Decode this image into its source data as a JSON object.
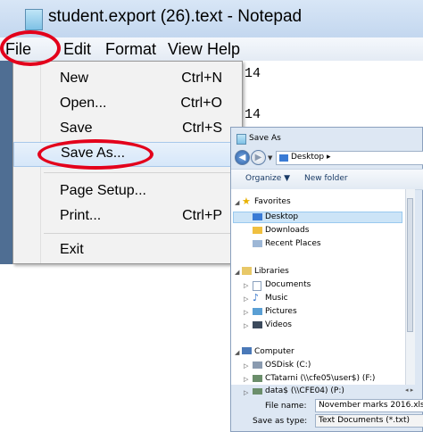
{
  "notepad": {
    "title": "student.export (26).text - Notepad",
    "menu": [
      "File",
      "Edit",
      "Format",
      "View",
      "Help"
    ],
    "text_fragments": [
      "14",
      "14"
    ]
  },
  "file_menu": {
    "items": [
      {
        "label": "New",
        "shortcut": "Ctrl+N"
      },
      {
        "label": "Open...",
        "shortcut": "Ctrl+O"
      },
      {
        "label": "Save",
        "shortcut": "Ctrl+S"
      },
      {
        "label": "Save As...",
        "shortcut": ""
      },
      {
        "label": "Page Setup...",
        "shortcut": ""
      },
      {
        "label": "Print...",
        "shortcut": "Ctrl+P"
      },
      {
        "label": "Exit",
        "shortcut": ""
      }
    ],
    "highlighted": "Save As..."
  },
  "dialog": {
    "title": "Save As",
    "address": "Desktop",
    "toolbar": {
      "organize": "Organize ▼",
      "new_folder": "New folder"
    },
    "tree": {
      "favorites": "Favorites",
      "desktop": "Desktop",
      "downloads": "Downloads",
      "recent_places": "Recent Places",
      "libraries": "Libraries",
      "documents": "Documents",
      "music": "Music",
      "pictures": "Pictures",
      "videos": "Videos",
      "computer": "Computer",
      "osdisk": "OSDisk (C:)",
      "ctatarni": "CTatarni (\\\\cfe05\\user$) (F:)",
      "data": "data$ (\\\\CFE04) (P:)"
    },
    "file_name_label": "File name:",
    "file_name_value": "November marks 2016.xls",
    "save_type_label": "Save as type:",
    "save_type_value": "Text Documents (*.txt)"
  },
  "colors": {
    "annotation_red": "#e3001b",
    "highlight": "#d6e7f9"
  }
}
